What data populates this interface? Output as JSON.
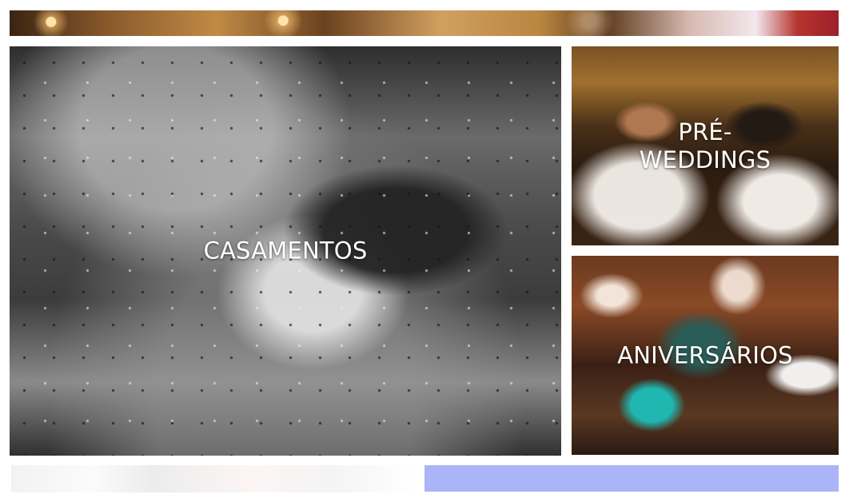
{
  "gallery": {
    "top_strip": {
      "label": ""
    },
    "tiles": [
      {
        "id": "casamentos",
        "label": "CASAMENTOS"
      },
      {
        "id": "pre-weddings",
        "label": "PRÉ-\nWEDDINGS"
      },
      {
        "id": "aniversarios",
        "label": "ANIVERSÁRIOS"
      }
    ],
    "bottom_left": {
      "label": ""
    },
    "bottom_right": {
      "label": "",
      "color": "#aab4f6"
    }
  },
  "colors": {
    "background": "#ffffff",
    "label_text": "#ffffff"
  }
}
